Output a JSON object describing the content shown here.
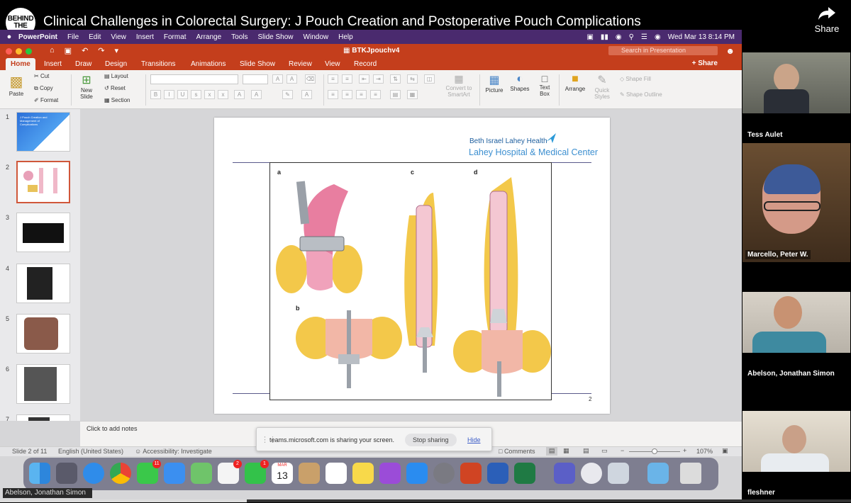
{
  "video": {
    "channel_logo": "BEHIND THE KNIFE",
    "title": "Clinical Challenges in Colorectal Surgery: J Pouch Creation and Postoperative Pouch Complications",
    "share_label": "Share",
    "progress": 0.29
  },
  "mac_menu": {
    "app": "PowerPoint",
    "items": [
      "File",
      "Edit",
      "View",
      "Insert",
      "Format",
      "Arrange",
      "Tools",
      "Slide Show",
      "Window",
      "Help"
    ],
    "clock": "Wed Mar 13  8:14 PM"
  },
  "ppt": {
    "doc_title": "BTKJpouchv4",
    "search_placeholder": "Search in Presentation",
    "tabs": [
      "Home",
      "Insert",
      "Draw",
      "Design",
      "Transitions",
      "Animations",
      "Slide Show",
      "Review",
      "View",
      "Record"
    ],
    "active_tab": "Home",
    "share": "Share",
    "ribbon": {
      "paste": "Paste",
      "cut": "Cut",
      "copy": "Copy",
      "format": "Format",
      "new_slide": "New Slide",
      "layout": "Layout",
      "reset": "Reset",
      "section": "Section",
      "convert": "Convert to SmartArt",
      "picture": "Picture",
      "shapes": "Shapes",
      "textbox": "Text Box",
      "arrange": "Arrange",
      "quick_styles": "Quick Styles",
      "shape_fill": "Shape Fill",
      "shape_outline": "Shape Outline"
    },
    "thumbnails": [
      {
        "num": "1",
        "title": "J Pouch Creation and Management of Complications"
      },
      {
        "num": "2"
      },
      {
        "num": "3"
      },
      {
        "num": "4"
      },
      {
        "num": "5"
      },
      {
        "num": "6"
      },
      {
        "num": "7"
      }
    ],
    "selected_slide": 2,
    "slide": {
      "org": "Beth Israel Lahey Health",
      "hospital": "Lahey Hospital & Medical Center",
      "panel_labels": [
        "a",
        "b",
        "c",
        "d"
      ],
      "page_number": "2"
    },
    "notes_placeholder": "Click to add notes",
    "status": {
      "slide_count": "Slide 2 of 11",
      "language": "English (United States)",
      "accessibility": "Accessibility: Investigate",
      "comments": "Comments",
      "zoom": "107%"
    }
  },
  "share_toast": {
    "message": "teams.microsoft.com is sharing your screen.",
    "stop": "Stop sharing",
    "hide": "Hide"
  },
  "dock": {
    "apps": [
      "finder-icon",
      "launchpad-icon",
      "safari-icon",
      "chrome-icon",
      "messages-icon",
      "mail-icon",
      "maps-icon",
      "photos-icon",
      "facetime-icon",
      "calendar-icon",
      "app-icon",
      "reminders-icon",
      "notes-icon",
      "podcasts-icon",
      "app-store-icon",
      "system-settings-icon",
      "powerpoint-icon",
      "word-icon",
      "excel-icon",
      "teams-icon",
      "quicktime-icon",
      "preview-icon",
      "folder-icon",
      "trash-icon"
    ],
    "badges": {
      "messages": "11",
      "photos": "2",
      "facetime": "1"
    },
    "calendar_month": "MAR",
    "calendar_day": "13"
  },
  "presenter_label": "Abelson, Jonathan Simon",
  "participants": [
    {
      "name": "Tess Aulet"
    },
    {
      "name": "Marcello, Peter W."
    },
    {
      "name": "Abelson, Jonathan Simon"
    },
    {
      "name": "fleshner"
    }
  ]
}
